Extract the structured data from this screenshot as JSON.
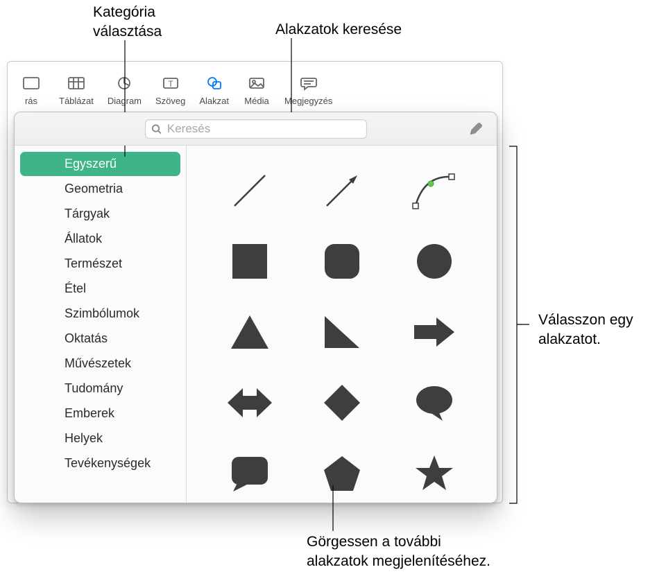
{
  "toolbar": {
    "items": [
      {
        "label": "rás",
        "icon": "insert-partial",
        "active": false
      },
      {
        "label": "Táblázat",
        "icon": "table",
        "active": false
      },
      {
        "label": "Diagram",
        "icon": "chart",
        "active": false
      },
      {
        "label": "Szöveg",
        "icon": "text",
        "active": false
      },
      {
        "label": "Alakzat",
        "icon": "shapes",
        "active": true
      },
      {
        "label": "Média",
        "icon": "media",
        "active": false
      },
      {
        "label": "Megjegyzés",
        "icon": "comment",
        "active": false
      }
    ]
  },
  "search": {
    "placeholder": "Keresés",
    "value": ""
  },
  "categories": [
    {
      "label": "Egyszerű",
      "selected": true
    },
    {
      "label": "Geometria",
      "selected": false
    },
    {
      "label": "Tárgyak",
      "selected": false
    },
    {
      "label": "Állatok",
      "selected": false
    },
    {
      "label": "Természet",
      "selected": false
    },
    {
      "label": "Étel",
      "selected": false
    },
    {
      "label": "Szimbólumok",
      "selected": false
    },
    {
      "label": "Oktatás",
      "selected": false
    },
    {
      "label": "Művészetek",
      "selected": false
    },
    {
      "label": "Tudomány",
      "selected": false
    },
    {
      "label": "Emberek",
      "selected": false
    },
    {
      "label": "Helyek",
      "selected": false
    },
    {
      "label": "Tevékenységek",
      "selected": false
    }
  ],
  "shapes": [
    "line",
    "arrow-line",
    "curve-editable",
    "square",
    "rounded-square",
    "circle",
    "triangle",
    "right-triangle",
    "arrow-right-block",
    "arrow-both-block",
    "diamond",
    "speech-bubble",
    "talk-rect",
    "pentagon",
    "star"
  ],
  "callouts": {
    "category": "Kategória\nválasztása",
    "search": "Alakzatok keresése",
    "select": "Válasszon egy\nalakzatot.",
    "scroll": "Görgessen a további\nalakzatok megjelenítéséhez."
  }
}
